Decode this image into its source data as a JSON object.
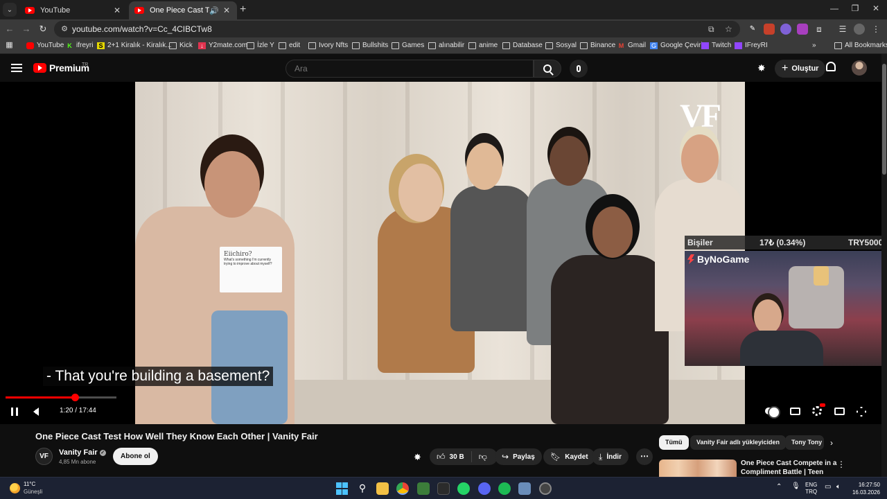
{
  "browser": {
    "tabs": [
      {
        "title": "YouTube"
      },
      {
        "title": "One Piece Cast Test How W"
      }
    ],
    "url": "youtube.com/watch?v=Cc_4CIBCTw8",
    "bookmarks": [
      {
        "label": "YouTube",
        "icon": "youtube-icon"
      },
      {
        "label": "ifreyri",
        "icon": "kick-icon"
      },
      {
        "label": "2+1 Kiralık - Kiralık...",
        "icon": "s-icon"
      },
      {
        "label": "Kick",
        "icon": "folder-icon"
      },
      {
        "label": "Y2mate.com",
        "icon": "y2mate-icon"
      },
      {
        "label": "İzle Y",
        "icon": "folder-icon"
      },
      {
        "label": "edit",
        "icon": "folder-icon"
      },
      {
        "label": "Ivory Nfts",
        "icon": "folder-icon"
      },
      {
        "label": "Bullshits",
        "icon": "folder-icon"
      },
      {
        "label": "Games",
        "icon": "folder-icon"
      },
      {
        "label": "alınabilir",
        "icon": "folder-icon"
      },
      {
        "label": "anime",
        "icon": "folder-icon"
      },
      {
        "label": "Database",
        "icon": "folder-icon"
      },
      {
        "label": "Sosyal",
        "icon": "folder-icon"
      },
      {
        "label": "Binance",
        "icon": "folder-icon"
      },
      {
        "label": "Gmail",
        "icon": "gmail-icon"
      },
      {
        "label": "Google Çeviri",
        "icon": "translate-icon"
      },
      {
        "label": "Twitch",
        "icon": "twitch-icon"
      },
      {
        "label": "IFreyRI",
        "icon": "twitch-icon"
      }
    ],
    "all_bookmarks": "All Bookmarks"
  },
  "youtube": {
    "logo": "Premium",
    "country": "TR",
    "search_placeholder": "Ara",
    "create_label": "Oluştur"
  },
  "player": {
    "caption": "- That you're building a basement?",
    "time": "1:20 / 17:44",
    "progress": 0.075,
    "watermark": "VF",
    "card_text": "Eiichiro?",
    "card_question": "What's something I'm currently trying to improve about myself?"
  },
  "overlay": {
    "donation_name": "Bişiler",
    "donation_amount": "17₺ (0.34%)",
    "donation_goal": "TRY5000",
    "streamer": "ByNoGame"
  },
  "video": {
    "title": "One Piece Cast Test How Well They Know Each Other | Vanity Fair",
    "channel_logo": "VF",
    "channel": "Vanity Fair",
    "subs": "4,85 Mn abone",
    "subscribe": "Abone ol",
    "likes": "30 B",
    "share": "Paylaş",
    "save": "Kaydet",
    "download": "İndir"
  },
  "chips": [
    "Tümü",
    "Vanity Fair adlı yükleyiciden",
    "Tony Tony"
  ],
  "recommendation": {
    "title": "One Piece Cast Compete in a Compliment Battle | Teen Vogue"
  },
  "taskbar": {
    "temp": "11°C",
    "weather": "Güneşli",
    "lang1": "ENG",
    "lang2": "TRQ",
    "time": "16:27:50",
    "date": "16.03.2026"
  },
  "colors": {
    "accent": "#ff0000",
    "background": "#0f0f0f",
    "chip_active": "#f1f1f1"
  }
}
